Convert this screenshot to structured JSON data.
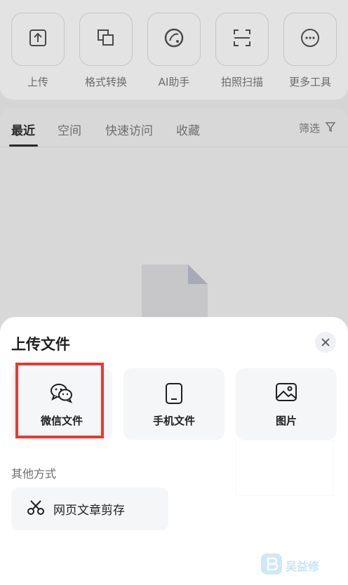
{
  "toolbar": {
    "tools": [
      {
        "label": "上传",
        "icon": "upload-icon"
      },
      {
        "label": "格式转换",
        "icon": "format-convert-icon"
      },
      {
        "label": "AI助手",
        "icon": "ai-assistant-icon"
      },
      {
        "label": "拍照扫描",
        "icon": "scan-icon"
      },
      {
        "label": "更多工具",
        "icon": "more-icon"
      }
    ]
  },
  "tabs": [
    {
      "label": "最近",
      "active": true
    },
    {
      "label": "空间",
      "active": false
    },
    {
      "label": "快速访问",
      "active": false
    },
    {
      "label": "收藏",
      "active": false
    }
  ],
  "filter": {
    "label": "筛选",
    "icon": "filter-icon"
  },
  "sheet": {
    "title": "上传文件",
    "close_icon": "close-icon",
    "options": [
      {
        "label": "微信文件",
        "icon": "wechat-icon",
        "highlighted": true
      },
      {
        "label": "手机文件",
        "icon": "phone-icon",
        "highlighted": false
      },
      {
        "label": "图片",
        "icon": "image-icon",
        "highlighted": false
      }
    ],
    "other_label": "其他方式",
    "other_items": [
      {
        "label": "网页文章剪存",
        "icon": "scissors-icon"
      }
    ]
  },
  "watermark": {
    "text": "吴益修"
  },
  "colors": {
    "highlight": "#e53935",
    "sheet_bg": "#ffffff",
    "overlay": "#d5d5d6"
  }
}
